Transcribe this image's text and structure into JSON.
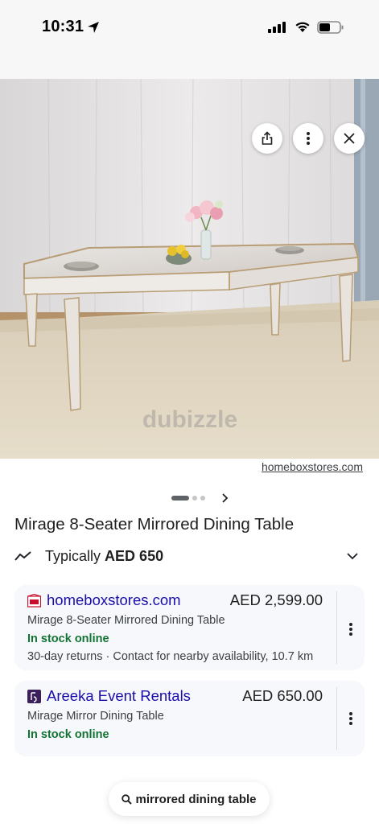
{
  "status_bar": {
    "time": "10:31"
  },
  "image_viewer": {
    "source_domain": "homeboxstores.com",
    "watermark": "dubizzle",
    "carousel": {
      "count": 3,
      "active_index": 0
    }
  },
  "product": {
    "title": "Mirage 8-Seater Mirrored Dining Table",
    "typically_label": "Typically",
    "typically_price": "AED 650"
  },
  "offers": [
    {
      "seller": "homeboxstores.com",
      "price": "AED 2,599.00",
      "description": "Mirage 8-Seater Mirrored Dining Table",
      "stock": "In stock online",
      "extra": "30-day returns · Contact for nearby availability, 10.7 km",
      "logo_color": "#c8102e"
    },
    {
      "seller": "Areeka Event Rentals",
      "price": "AED 650.00",
      "description": "Mirage Mirror Dining Table",
      "stock": "In stock online",
      "logo_color": "#3b1f5a"
    }
  ],
  "search": {
    "query": "mirrored dining table"
  },
  "colors": {
    "link": "#1a0dab",
    "in_stock": "#137333",
    "card_bg": "#f6f8fb"
  }
}
